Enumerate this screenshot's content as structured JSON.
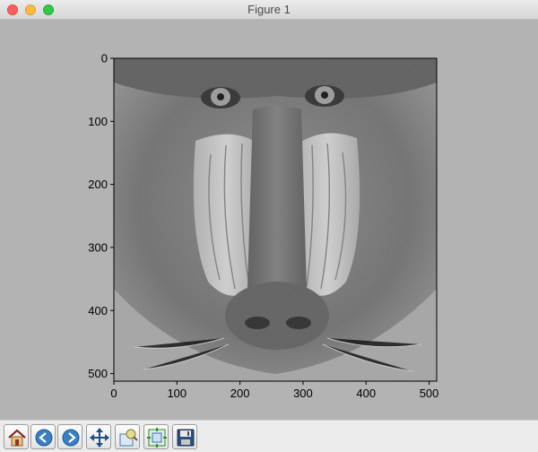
{
  "window": {
    "title": "Figure 1",
    "controls": [
      "close",
      "minimize",
      "zoom"
    ]
  },
  "chart_data": {
    "type": "image",
    "title": "",
    "xlabel": "",
    "ylabel": "",
    "xlim": [
      0,
      512
    ],
    "ylim": [
      512,
      0
    ],
    "x_ticks": [
      0,
      100,
      200,
      300,
      400,
      500
    ],
    "y_ticks": [
      0,
      100,
      200,
      300,
      400,
      500
    ],
    "colormap": "gray",
    "grid": false
  },
  "toolbar": {
    "buttons": [
      {
        "name": "home",
        "icon": "home-icon"
      },
      {
        "name": "back",
        "icon": "back-arrow-icon"
      },
      {
        "name": "forward",
        "icon": "forward-arrow-icon"
      },
      {
        "name": "pan",
        "icon": "move-icon"
      },
      {
        "name": "zoom",
        "icon": "zoom-rect-icon"
      },
      {
        "name": "subplots",
        "icon": "subplots-icon"
      },
      {
        "name": "save",
        "icon": "floppy-icon"
      }
    ]
  },
  "colors": {
    "figure_bg": "#b3b3b3",
    "toolbar_bg": "#ececec",
    "accent_blue": "#3a7fc4"
  }
}
